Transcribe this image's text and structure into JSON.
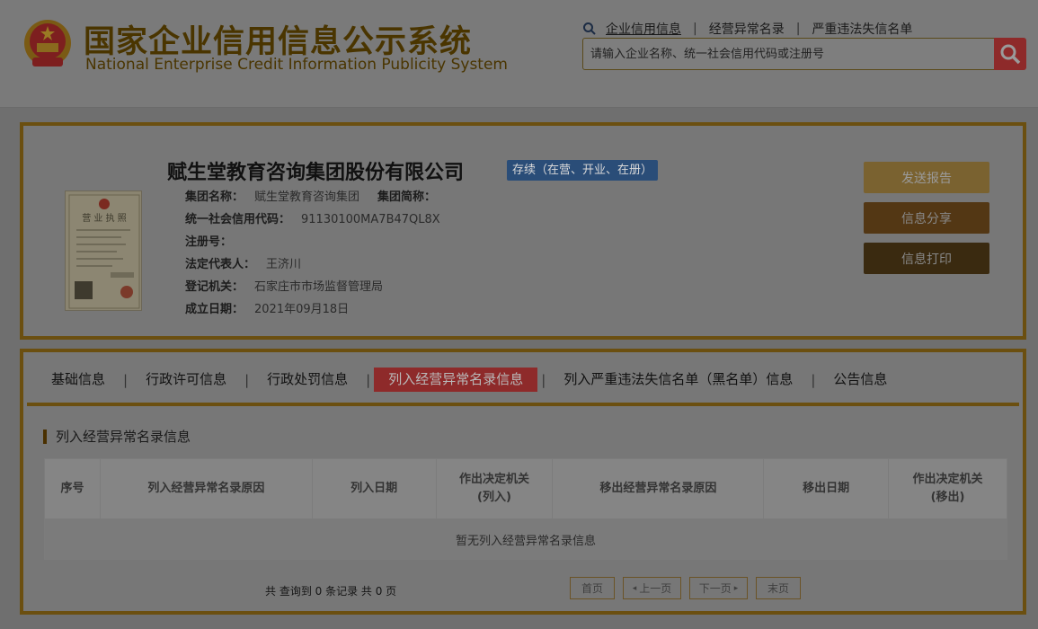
{
  "header": {
    "title_cn": "国家企业信用信息公示系统",
    "title_en": "National Enterprise Credit Information Publicity System",
    "nav": [
      "企业信用信息",
      "经营异常名录",
      "严重违法失信名单"
    ],
    "search_placeholder": "请输入企业名称、统一社会信用代码或注册号"
  },
  "company": {
    "name": "赋生堂教育咨询集团股份有限公司",
    "status": "存续（在营、开业、在册）",
    "fields": {
      "group_name_label": "集团名称：",
      "group_name": "赋生堂教育咨询集团",
      "group_abbr_label": "集团简称：",
      "credit_code_label": "统一社会信用代码：",
      "credit_code": "91130100MA7B47QL8X",
      "reg_no_label": "注册号：",
      "legal_rep_label": "法定代表人：",
      "legal_rep": "王济川",
      "authority_label": "登记机关：",
      "authority": "石家庄市市场监督管理局",
      "est_date_label": "成立日期：",
      "est_date": "2021年09月18日"
    },
    "buttons": {
      "send": "发送报告",
      "share": "信息分享",
      "print": "信息打印"
    }
  },
  "tabs": [
    "基础信息",
    "行政许可信息",
    "行政处罚信息",
    "列入经营异常名录信息",
    "列入严重违法失信名单（黑名单）信息",
    "公告信息"
  ],
  "active_tab_index": 3,
  "section": {
    "title": "列入经营异常名录信息",
    "columns": [
      "序号",
      "列入经营异常名录原因",
      "列入日期",
      "作出决定机关\n(列入)",
      "移出经营异常名录原因",
      "移出日期",
      "作出决定机关\n(移出)"
    ],
    "empty_text": "暂无列入经营异常名录信息"
  },
  "pagination": {
    "summary": "共 查询到 0 条记录 共 0 页",
    "first": "首页",
    "prev": "上一页",
    "next": "下一页",
    "last": "末页"
  },
  "colors": {
    "brand_brown": "#6b4f10",
    "active_tab": "#8e2a2a",
    "status_blue": "#2a4d78"
  }
}
